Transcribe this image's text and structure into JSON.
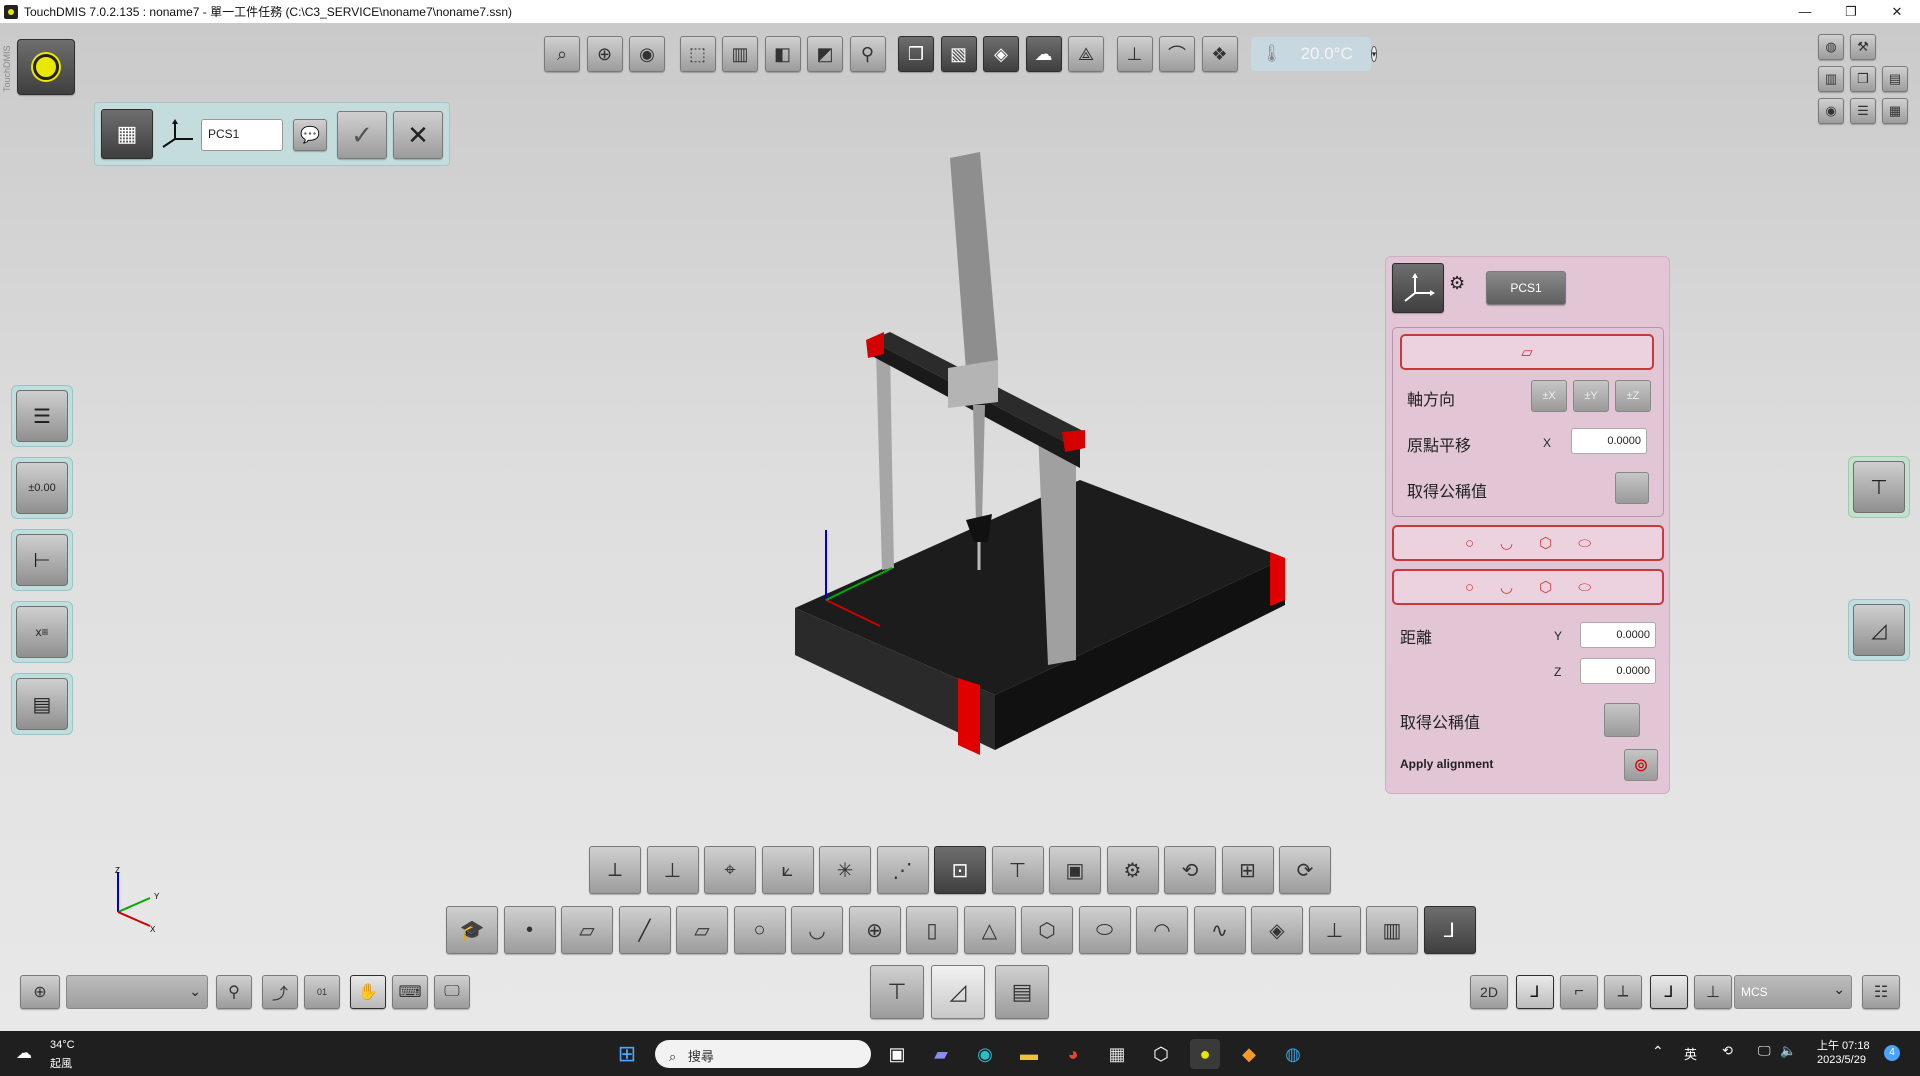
{
  "window": {
    "title": "TouchDMIS 7.0.2.135 : noname7 - 單一工件任務    (C:\\C3_SERVICE\\noname7\\noname7.ssn)",
    "controls": [
      "—",
      "❐",
      "✕"
    ]
  },
  "brand": {
    "vertical_text": "TouchDMIS"
  },
  "top_toolbar": {
    "icons": [
      "zoom-fit-icon",
      "zoom-window-icon",
      "view-eye-icon",
      "view-iso-icon",
      "view-front-icon",
      "view-side-icon",
      "view-section-icon",
      "probe-view-icon",
      "view-cube-icon",
      "view-wire-icon",
      "view-shade-icon",
      "view-cloud-icon",
      "view-mesh-icon",
      "probe-touch-icon",
      "arm-icon",
      "view-multi-icon"
    ],
    "temperature": "20.0°C"
  },
  "right_top_icons": [
    "globe-icon",
    "wrench-icon",
    "gauge-icon",
    "cube-icon",
    "layout-icon",
    "eye-icon",
    "list-icon",
    "report-icon"
  ],
  "pcs_bar": {
    "name": "PCS1"
  },
  "alignment_panel": {
    "pcs_button": "PCS1",
    "axis_direction_label": "軸方向",
    "axis_buttons": [
      "±X",
      "±Y",
      "±Z"
    ],
    "origin_shift_label": "原點平移",
    "x_label": "X",
    "x_value": "0.0000",
    "get_nominal_label_1": "取得公稱值",
    "distance_label": "距離",
    "y_label": "Y",
    "y_value": "0.0000",
    "z_label": "Z",
    "z_value": "0.0000",
    "get_nominal_label_2": "取得公稱值",
    "apply_label": "Apply alignment"
  },
  "triad": {
    "x": "X",
    "y": "Y",
    "z": "Z"
  },
  "bottom_bar": {
    "view_2d": "2D",
    "mcs_select": "MCS"
  },
  "taskbar": {
    "weather_temp": "34°C",
    "weather_desc": "起風",
    "search_placeholder": "搜尋",
    "lang": "英",
    "time": "上午 07:18",
    "date": "2023/5/29",
    "notif_count": "4"
  }
}
